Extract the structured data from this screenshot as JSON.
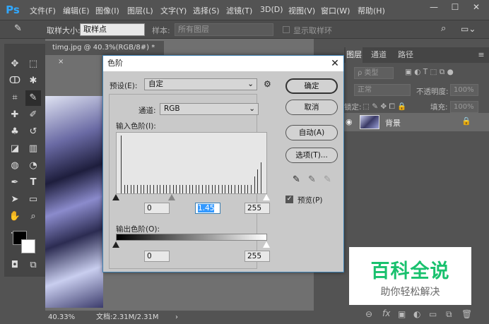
{
  "app": {
    "logo": "Ps",
    "menu": [
      "文件(F)",
      "编辑(E)",
      "图像(I)",
      "图层(L)",
      "文字(Y)",
      "选择(S)",
      "滤镜(T)",
      "3D(D)",
      "视图(V)",
      "窗口(W)",
      "帮助(H)"
    ],
    "window_controls": {
      "minimize": "—",
      "maximize": "☐",
      "close": "✕"
    }
  },
  "options_bar": {
    "sample_size_label": "取样大小:",
    "sample_size_value": "取样点",
    "sample_label": "样本:",
    "sample_value": "所有图层",
    "show_ring_label": "显示取样环"
  },
  "document": {
    "tab_title": "timg.jpg @ 40.3%(RGB/8#) *",
    "tab_close": "×",
    "zoom": "40.33%",
    "doc_size": "文档:2.31M/2.31M"
  },
  "levels_dialog": {
    "title": "色阶",
    "close": "✕",
    "preset_label": "预设(E):",
    "preset_value": "自定",
    "channel_label": "通道:",
    "channel_value": "RGB",
    "input_label": "输入色阶(I):",
    "input_black": "0",
    "input_gamma": "1.45",
    "input_white": "255",
    "output_label": "输出色阶(O):",
    "output_black": "0",
    "output_white": "255",
    "ok": "确定",
    "cancel": "取消",
    "auto": "自动(A)",
    "options": "选项(T)...",
    "preview_label": "预览(P)",
    "preview_checked": true
  },
  "layers_panel": {
    "tabs": [
      "图层",
      "通道",
      "路径"
    ],
    "kind_filter": "ρ 类型",
    "blend_mode": "正常",
    "opacity_label": "不透明度:",
    "opacity_value": "100%",
    "lock_label": "锁定:",
    "fill_label": "填充:",
    "fill_value": "100%",
    "layer_name": "背景"
  },
  "watermark": {
    "title": "百科全说",
    "subtitle": "助你轻松解决"
  },
  "colors": {
    "brand": "#31a8ff",
    "watermark": "#19c16e",
    "dialog_border": "#3c7fb1"
  }
}
